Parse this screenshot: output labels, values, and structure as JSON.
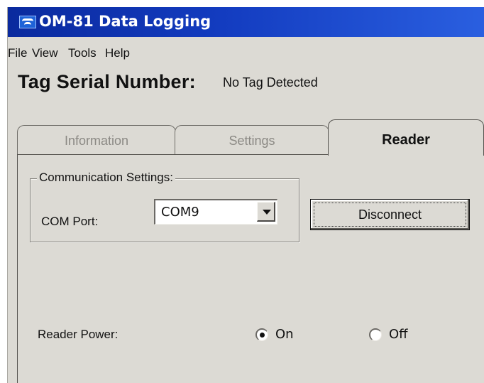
{
  "window": {
    "title": "OM-81 Data Logging",
    "app_icon": "omega-logo-icon"
  },
  "menubar": {
    "items": [
      "File",
      "View",
      "Tools",
      "Help"
    ]
  },
  "tag": {
    "label": "Tag Serial Number:",
    "value": "No Tag Detected"
  },
  "tabs": [
    {
      "label": "Information",
      "active": false
    },
    {
      "label": "Settings",
      "active": false
    },
    {
      "label": "Reader",
      "active": true
    }
  ],
  "communication": {
    "group_label": "Communication Settings:",
    "com_port_label": "COM Port:",
    "com_port_value": "COM9",
    "dropdown_icon": "chevron-down-icon",
    "disconnect_label": "Disconnect"
  },
  "reader_power": {
    "label": "Reader Power:",
    "options": [
      {
        "label": "On",
        "selected": true
      },
      {
        "label": "Off",
        "selected": false
      }
    ]
  },
  "colors": {
    "titlebar": "#133cc0",
    "window_bg": "#dcdad4"
  }
}
